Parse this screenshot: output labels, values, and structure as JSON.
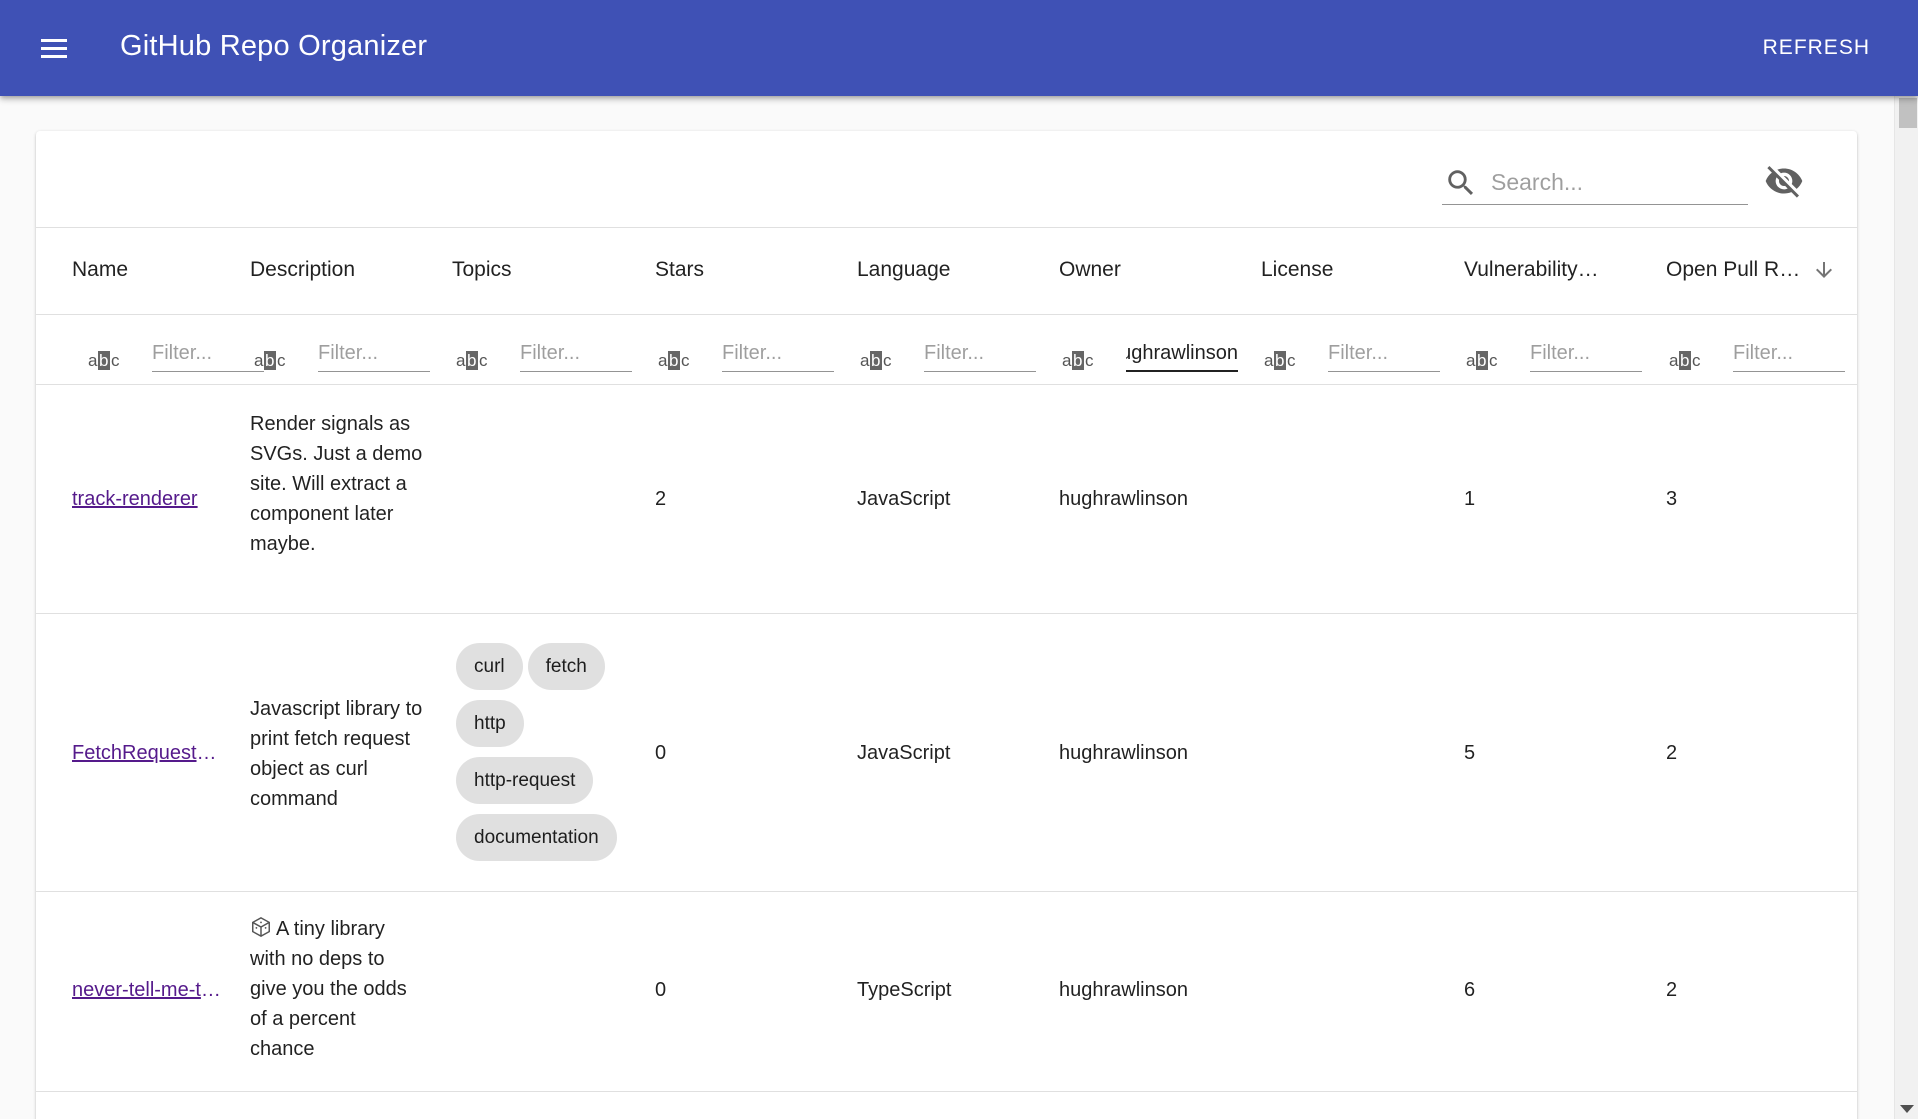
{
  "appbar": {
    "title": "GitHub Repo Organizer",
    "refresh_label": "REFRESH",
    "color": "#3f51b5"
  },
  "search": {
    "placeholder": "Search..."
  },
  "columns": [
    {
      "label": "Name"
    },
    {
      "label": "Description"
    },
    {
      "label": "Topics"
    },
    {
      "label": "Stars"
    },
    {
      "label": "Language"
    },
    {
      "label": "Owner"
    },
    {
      "label": "License"
    },
    {
      "label": "Vulnerability…"
    },
    {
      "label": "Open Pull R…"
    }
  ],
  "filters": {
    "placeholder": "Filter...",
    "owner_value": "hughrawlinson"
  },
  "rows": [
    {
      "name": "track-renderer",
      "description": "Render signals as SVGs. Just a demo site. Will extract a component later maybe.",
      "topics": [],
      "stars": "2",
      "language": "JavaScript",
      "owner": "hughrawlinson",
      "license": "",
      "vulnerabilities": "1",
      "open_prs": "3"
    },
    {
      "name": "FetchRequestToCurl",
      "description": "Javascript library to print fetch request object as curl command",
      "topics": [
        "curl",
        "fetch",
        "http",
        "http-request",
        "documentation"
      ],
      "stars": "0",
      "language": "JavaScript",
      "owner": "hughrawlinson",
      "license": "",
      "vulnerabilities": "5",
      "open_prs": "2"
    },
    {
      "name": "never-tell-me-the-odds",
      "description": "A tiny library with no deps to give you the odds of a percent chance",
      "description_icon": "cube-icon",
      "topics": [],
      "stars": "0",
      "language": "TypeScript",
      "owner": "hughrawlinson",
      "license": "",
      "vulnerabilities": "6",
      "open_prs": "2"
    }
  ]
}
